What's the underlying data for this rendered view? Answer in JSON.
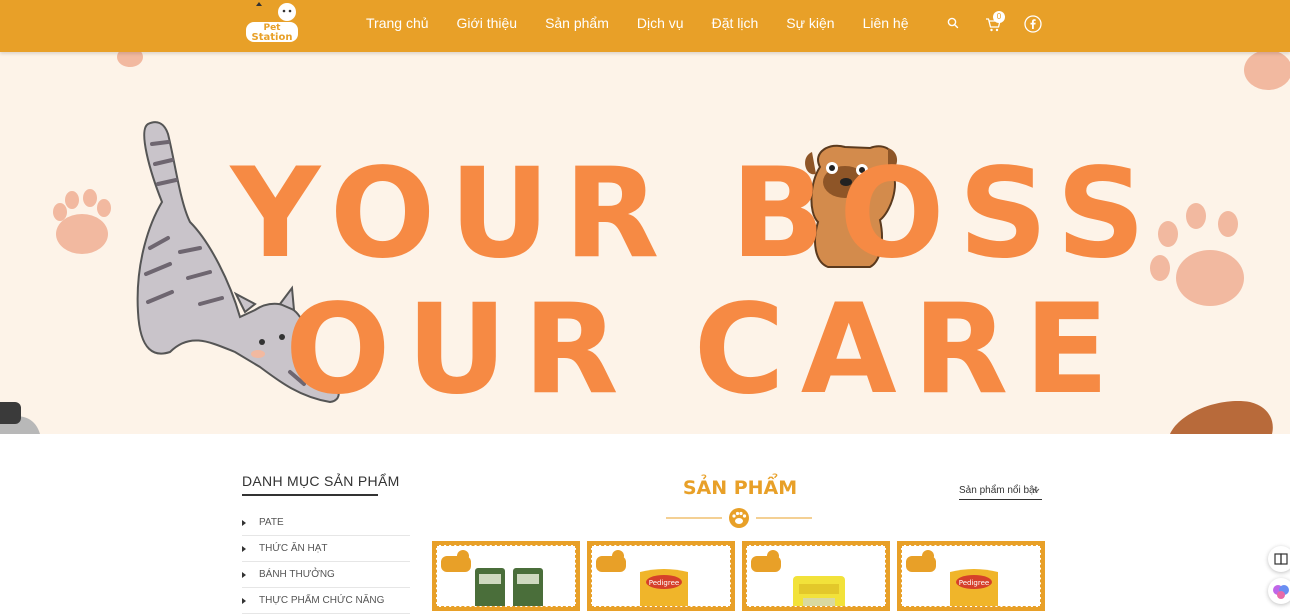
{
  "header": {
    "logo_text": "Pet Station",
    "nav": [
      "Trang chủ",
      "Giới thiệu",
      "Sản phẩm",
      "Dịch vụ",
      "Đặt lịch",
      "Sự kiện",
      "Liên hệ"
    ],
    "cart_count": "0",
    "icons": [
      "search-icon",
      "cart-icon",
      "facebook-icon"
    ],
    "accent_color": "#e8a028"
  },
  "hero": {
    "line1": "YOUR BOSS",
    "line2": "OUR CARE",
    "text_color": "#f68a44",
    "background": "#fdf3e8"
  },
  "sidebar": {
    "title": "DANH MỤC SẢN PHẨM",
    "items": [
      "PATE",
      "THỨC ĂN HẠT",
      "BÁNH THƯỞNG",
      "THỰC PHẨM CHỨC NĂNG"
    ]
  },
  "products": {
    "title": "SẢN PHẨM",
    "sort_label": "Sản phẩm nổi bật",
    "items": [
      {
        "brand": "",
        "image": "green-food-bags"
      },
      {
        "brand": "Pedigree",
        "image": "pedigree-bag"
      },
      {
        "brand": "",
        "image": "yellow-food-bag"
      },
      {
        "brand": "Pedigree",
        "image": "pedigree-bag"
      }
    ]
  }
}
